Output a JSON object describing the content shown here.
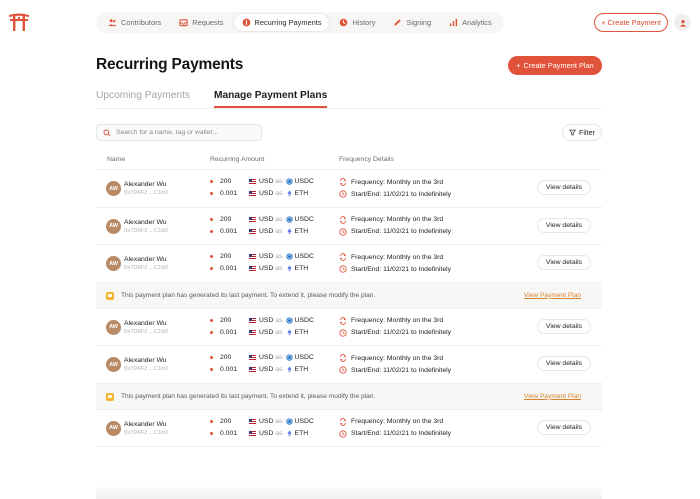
{
  "nav": {
    "items": [
      {
        "label": "Contributors",
        "icon": "users-icon",
        "active": false
      },
      {
        "label": "Requests",
        "icon": "inbox-icon",
        "active": false
      },
      {
        "label": "Recurring Payments",
        "icon": "recurring-icon",
        "active": true
      },
      {
        "label": "History",
        "icon": "history-icon",
        "active": false
      },
      {
        "label": "Signing",
        "icon": "pen-icon",
        "active": false
      },
      {
        "label": "Analytics",
        "icon": "bar-chart-icon",
        "active": false
      }
    ],
    "create_payment_label": "+ Create Payment"
  },
  "page": {
    "title": "Recurring Payments",
    "create_plan_label": "Create Payment Plan",
    "tabs": [
      {
        "label": "Upcoming Payments",
        "active": false
      },
      {
        "label": "Manage Payment Plans",
        "active": true
      }
    ],
    "search_placeholder": "Search for a name, tag or wallet...",
    "filter_label": "Filter"
  },
  "table": {
    "headers": {
      "name": "Name",
      "amount": "Recurring Amount",
      "frequency": "Frequency Details"
    },
    "as_word": "as",
    "rows": [
      {
        "type": "plan",
        "initials": "AW",
        "name": "Alexander Wu",
        "address": "0x7D6F2 ...C1b0",
        "amount1": "200",
        "cur1": "USD",
        "token1": "USDC",
        "amount2": "0.001",
        "cur2": "USD",
        "token2": "ETH",
        "frequency": "Frequency: Monthly on the 3rd",
        "startend": "Start/End: 11/02/21 to Indefinitely",
        "details": "View details"
      },
      {
        "type": "plan",
        "initials": "AW",
        "name": "Alexander Wu",
        "address": "0x7D6F2 ...C1b0",
        "amount1": "200",
        "cur1": "USD",
        "token1": "USDC",
        "amount2": "0.001",
        "cur2": "USD",
        "token2": "ETH",
        "frequency": "Frequency: Monthly on the 3rd",
        "startend": "Start/End: 11/02/21 to Indefinitely",
        "details": "View details"
      },
      {
        "type": "plan",
        "initials": "AW",
        "name": "Alexander Wu",
        "address": "0x7D6F2 ...C1b0",
        "amount1": "200",
        "cur1": "USD",
        "token1": "USDC",
        "amount2": "0.001",
        "cur2": "USD",
        "token2": "ETH",
        "frequency": "Frequency: Monthly on the 3rd",
        "startend": "Start/End: 11/02/21 to Indefinitely",
        "details": "View details"
      },
      {
        "type": "notice",
        "text": "This payment plan has generated its last payment. To extend it, please modify the plan.",
        "link": "View Payment Plan"
      },
      {
        "type": "plan",
        "initials": "AW",
        "name": "Alexander Wu",
        "address": "0x7D6F2 ...C1b0",
        "amount1": "200",
        "cur1": "USD",
        "token1": "USDC",
        "amount2": "0.001",
        "cur2": "USD",
        "token2": "ETH",
        "frequency": "Frequency: Monthly on the 3rd",
        "startend": "Start/End: 11/02/21 to Indefinitely",
        "details": "View details"
      },
      {
        "type": "plan",
        "initials": "AW",
        "name": "Alexander Wu",
        "address": "0x7D6F2 ...C1b0",
        "amount1": "200",
        "cur1": "USD",
        "token1": "USDC",
        "amount2": "0.001",
        "cur2": "USD",
        "token2": "ETH",
        "frequency": "Frequency: Monthly on the 3rd",
        "startend": "Start/End: 11/02/21 to Indefinitely",
        "details": "View details"
      },
      {
        "type": "notice",
        "text": "This payment plan has generated its last payment. To extend it, please modify the plan.",
        "link": "View Payment Plan"
      },
      {
        "type": "plan",
        "initials": "AW",
        "name": "Alexander Wu",
        "address": "0x7D6F2 ...C1b0",
        "amount1": "200",
        "cur1": "USD",
        "token1": "USDC",
        "amount2": "0.001",
        "cur2": "USD",
        "token2": "ETH",
        "frequency": "Frequency: Monthly on the 3rd",
        "startend": "Start/End: 11/02/21 to Indefinitely",
        "details": "View details"
      }
    ]
  },
  "colors": {
    "accent": "#e0533a",
    "warning": "#f5b52f",
    "link": "#d9822b"
  }
}
